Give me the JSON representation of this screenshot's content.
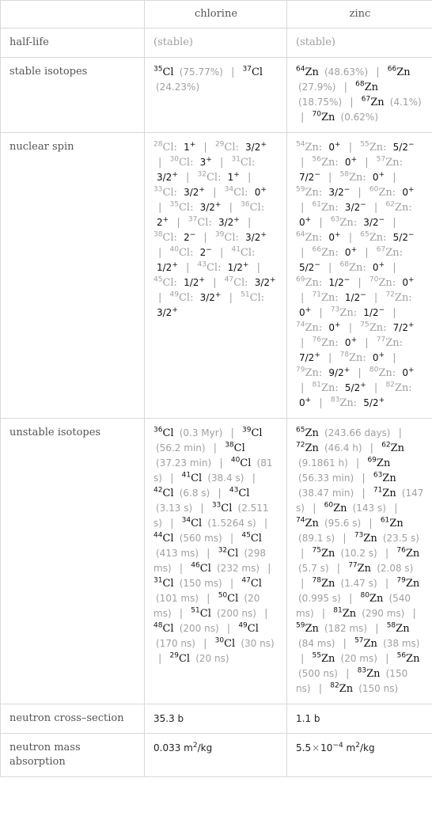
{
  "header": {
    "corner": "",
    "columns": [
      "chlorine",
      "zinc"
    ]
  },
  "rows": {
    "half_life": {
      "label": "half-life",
      "chlorine": "(stable)",
      "zinc": "(stable)"
    },
    "stable_isotopes": {
      "label": "stable isotopes",
      "chlorine": [
        {
          "mass": "35",
          "symbol": "Cl",
          "abundance": "(75.77%)"
        },
        {
          "mass": "37",
          "symbol": "Cl",
          "abundance": "(24.23%)"
        }
      ],
      "zinc": [
        {
          "mass": "64",
          "symbol": "Zn",
          "abundance": "(48.63%)"
        },
        {
          "mass": "66",
          "symbol": "Zn",
          "abundance": "(27.9%)"
        },
        {
          "mass": "68",
          "symbol": "Zn",
          "abundance": "(18.75%)"
        },
        {
          "mass": "67",
          "symbol": "Zn",
          "abundance": "(4.1%)"
        },
        {
          "mass": "70",
          "symbol": "Zn",
          "abundance": "(0.62%)"
        }
      ]
    },
    "nuclear_spin": {
      "label": "nuclear spin",
      "chlorine": [
        {
          "mass": "28",
          "symbol": "Cl",
          "spin": "1",
          "parity": "+"
        },
        {
          "mass": "29",
          "symbol": "Cl",
          "spin": "3/2",
          "parity": "+"
        },
        {
          "mass": "30",
          "symbol": "Cl",
          "spin": "3",
          "parity": "+"
        },
        {
          "mass": "31",
          "symbol": "Cl",
          "spin": "3/2",
          "parity": "+"
        },
        {
          "mass": "32",
          "symbol": "Cl",
          "spin": "1",
          "parity": "+"
        },
        {
          "mass": "33",
          "symbol": "Cl",
          "spin": "3/2",
          "parity": "+"
        },
        {
          "mass": "34",
          "symbol": "Cl",
          "spin": "0",
          "parity": "+"
        },
        {
          "mass": "35",
          "symbol": "Cl",
          "spin": "3/2",
          "parity": "+"
        },
        {
          "mass": "36",
          "symbol": "Cl",
          "spin": "2",
          "parity": "+"
        },
        {
          "mass": "37",
          "symbol": "Cl",
          "spin": "3/2",
          "parity": "+"
        },
        {
          "mass": "38",
          "symbol": "Cl",
          "spin": "2",
          "parity": "−"
        },
        {
          "mass": "39",
          "symbol": "Cl",
          "spin": "3/2",
          "parity": "+"
        },
        {
          "mass": "40",
          "symbol": "Cl",
          "spin": "2",
          "parity": "−"
        },
        {
          "mass": "41",
          "symbol": "Cl",
          "spin": "1/2",
          "parity": "+"
        },
        {
          "mass": "43",
          "symbol": "Cl",
          "spin": "1/2",
          "parity": "+"
        },
        {
          "mass": "45",
          "symbol": "Cl",
          "spin": "1/2",
          "parity": "+"
        },
        {
          "mass": "47",
          "symbol": "Cl",
          "spin": "3/2",
          "parity": "+"
        },
        {
          "mass": "49",
          "symbol": "Cl",
          "spin": "3/2",
          "parity": "+"
        },
        {
          "mass": "51",
          "symbol": "Cl",
          "spin": "3/2",
          "parity": "+"
        }
      ],
      "zinc": [
        {
          "mass": "54",
          "symbol": "Zn",
          "spin": "0",
          "parity": "+"
        },
        {
          "mass": "55",
          "symbol": "Zn",
          "spin": "5/2",
          "parity": "−"
        },
        {
          "mass": "56",
          "symbol": "Zn",
          "spin": "0",
          "parity": "+"
        },
        {
          "mass": "57",
          "symbol": "Zn",
          "spin": "7/2",
          "parity": "−"
        },
        {
          "mass": "58",
          "symbol": "Zn",
          "spin": "0",
          "parity": "+"
        },
        {
          "mass": "59",
          "symbol": "Zn",
          "spin": "3/2",
          "parity": "−"
        },
        {
          "mass": "60",
          "symbol": "Zn",
          "spin": "0",
          "parity": "+"
        },
        {
          "mass": "61",
          "symbol": "Zn",
          "spin": "3/2",
          "parity": "−"
        },
        {
          "mass": "62",
          "symbol": "Zn",
          "spin": "0",
          "parity": "+"
        },
        {
          "mass": "63",
          "symbol": "Zn",
          "spin": "3/2",
          "parity": "−"
        },
        {
          "mass": "64",
          "symbol": "Zn",
          "spin": "0",
          "parity": "+"
        },
        {
          "mass": "65",
          "symbol": "Zn",
          "spin": "5/2",
          "parity": "−"
        },
        {
          "mass": "66",
          "symbol": "Zn",
          "spin": "0",
          "parity": "+"
        },
        {
          "mass": "67",
          "symbol": "Zn",
          "spin": "5/2",
          "parity": "−"
        },
        {
          "mass": "68",
          "symbol": "Zn",
          "spin": "0",
          "parity": "+"
        },
        {
          "mass": "69",
          "symbol": "Zn",
          "spin": "1/2",
          "parity": "−"
        },
        {
          "mass": "70",
          "symbol": "Zn",
          "spin": "0",
          "parity": "+"
        },
        {
          "mass": "71",
          "symbol": "Zn",
          "spin": "1/2",
          "parity": "−"
        },
        {
          "mass": "72",
          "symbol": "Zn",
          "spin": "0",
          "parity": "+"
        },
        {
          "mass": "73",
          "symbol": "Zn",
          "spin": "1/2",
          "parity": "−"
        },
        {
          "mass": "74",
          "symbol": "Zn",
          "spin": "0",
          "parity": "+"
        },
        {
          "mass": "75",
          "symbol": "Zn",
          "spin": "7/2",
          "parity": "+"
        },
        {
          "mass": "76",
          "symbol": "Zn",
          "spin": "0",
          "parity": "+"
        },
        {
          "mass": "77",
          "symbol": "Zn",
          "spin": "7/2",
          "parity": "+"
        },
        {
          "mass": "78",
          "symbol": "Zn",
          "spin": "0",
          "parity": "+"
        },
        {
          "mass": "79",
          "symbol": "Zn",
          "spin": "9/2",
          "parity": "+"
        },
        {
          "mass": "80",
          "symbol": "Zn",
          "spin": "0",
          "parity": "+"
        },
        {
          "mass": "81",
          "symbol": "Zn",
          "spin": "5/2",
          "parity": "+"
        },
        {
          "mass": "82",
          "symbol": "Zn",
          "spin": "0",
          "parity": "+"
        },
        {
          "mass": "83",
          "symbol": "Zn",
          "spin": "5/2",
          "parity": "+"
        }
      ]
    },
    "unstable_isotopes": {
      "label": "unstable isotopes",
      "chlorine": [
        {
          "mass": "36",
          "symbol": "Cl",
          "half_life": "(0.3 Myr)"
        },
        {
          "mass": "39",
          "symbol": "Cl",
          "half_life": "(56.2 min)"
        },
        {
          "mass": "38",
          "symbol": "Cl",
          "half_life": "(37.23 min)"
        },
        {
          "mass": "40",
          "symbol": "Cl",
          "half_life": "(81 s)"
        },
        {
          "mass": "41",
          "symbol": "Cl",
          "half_life": "(38.4 s)"
        },
        {
          "mass": "42",
          "symbol": "Cl",
          "half_life": "(6.8 s)"
        },
        {
          "mass": "43",
          "symbol": "Cl",
          "half_life": "(3.13 s)"
        },
        {
          "mass": "33",
          "symbol": "Cl",
          "half_life": "(2.511 s)"
        },
        {
          "mass": "34",
          "symbol": "Cl",
          "half_life": "(1.5264 s)"
        },
        {
          "mass": "44",
          "symbol": "Cl",
          "half_life": "(560 ms)"
        },
        {
          "mass": "45",
          "symbol": "Cl",
          "half_life": "(413 ms)"
        },
        {
          "mass": "32",
          "symbol": "Cl",
          "half_life": "(298 ms)"
        },
        {
          "mass": "46",
          "symbol": "Cl",
          "half_life": "(232 ms)"
        },
        {
          "mass": "31",
          "symbol": "Cl",
          "half_life": "(150 ms)"
        },
        {
          "mass": "47",
          "symbol": "Cl",
          "half_life": "(101 ms)"
        },
        {
          "mass": "50",
          "symbol": "Cl",
          "half_life": "(20 ms)"
        },
        {
          "mass": "51",
          "symbol": "Cl",
          "half_life": "(200 ns)"
        },
        {
          "mass": "48",
          "symbol": "Cl",
          "half_life": "(200 ns)"
        },
        {
          "mass": "49",
          "symbol": "Cl",
          "half_life": "(170 ns)"
        },
        {
          "mass": "30",
          "symbol": "Cl",
          "half_life": "(30 ns)"
        },
        {
          "mass": "29",
          "symbol": "Cl",
          "half_life": "(20 ns)"
        }
      ],
      "zinc": [
        {
          "mass": "65",
          "symbol": "Zn",
          "half_life": "(243.66 days)"
        },
        {
          "mass": "72",
          "symbol": "Zn",
          "half_life": "(46.4 h)"
        },
        {
          "mass": "62",
          "symbol": "Zn",
          "half_life": "(9.1861 h)"
        },
        {
          "mass": "69",
          "symbol": "Zn",
          "half_life": "(56.33 min)"
        },
        {
          "mass": "63",
          "symbol": "Zn",
          "half_life": "(38.47 min)"
        },
        {
          "mass": "71",
          "symbol": "Zn",
          "half_life": "(147 s)"
        },
        {
          "mass": "60",
          "symbol": "Zn",
          "half_life": "(143 s)"
        },
        {
          "mass": "74",
          "symbol": "Zn",
          "half_life": "(95.6 s)"
        },
        {
          "mass": "61",
          "symbol": "Zn",
          "half_life": "(89.1 s)"
        },
        {
          "mass": "73",
          "symbol": "Zn",
          "half_life": "(23.5 s)"
        },
        {
          "mass": "75",
          "symbol": "Zn",
          "half_life": "(10.2 s)"
        },
        {
          "mass": "76",
          "symbol": "Zn",
          "half_life": "(5.7 s)"
        },
        {
          "mass": "77",
          "symbol": "Zn",
          "half_life": "(2.08 s)"
        },
        {
          "mass": "78",
          "symbol": "Zn",
          "half_life": "(1.47 s)"
        },
        {
          "mass": "79",
          "symbol": "Zn",
          "half_life": "(0.995 s)"
        },
        {
          "mass": "80",
          "symbol": "Zn",
          "half_life": "(540 ms)"
        },
        {
          "mass": "81",
          "symbol": "Zn",
          "half_life": "(290 ms)"
        },
        {
          "mass": "59",
          "symbol": "Zn",
          "half_life": "(182 ms)"
        },
        {
          "mass": "58",
          "symbol": "Zn",
          "half_life": "(84 ms)"
        },
        {
          "mass": "57",
          "symbol": "Zn",
          "half_life": "(38 ms)"
        },
        {
          "mass": "55",
          "symbol": "Zn",
          "half_life": "(20 ms)"
        },
        {
          "mass": "56",
          "symbol": "Zn",
          "half_life": "(500 ns)"
        },
        {
          "mass": "83",
          "symbol": "Zn",
          "half_life": "(150 ns)"
        },
        {
          "mass": "82",
          "symbol": "Zn",
          "half_life": "(150 ns)"
        }
      ]
    },
    "neutron_cross_section": {
      "label": "neutron cross–section",
      "chlorine": "35.3 b",
      "zinc": "1.1 b"
    },
    "neutron_mass_absorption": {
      "label": "neutron mass absorption",
      "chlorine": {
        "mantissa": "0.033",
        "exponent": "",
        "unit_base": " m",
        "unit_power": "2",
        "unit_rest": "/kg"
      },
      "zinc": {
        "mantissa": "5.5",
        "times": "×",
        "base": "10",
        "exponent": "−4",
        "unit_base": " m",
        "unit_power": "2",
        "unit_rest": "/kg"
      }
    }
  },
  "separator": "|",
  "colors": {
    "border": "#d9d9d9",
    "label_text": "#555555",
    "muted_text": "#a0a0a0",
    "value_text": "#111111"
  }
}
